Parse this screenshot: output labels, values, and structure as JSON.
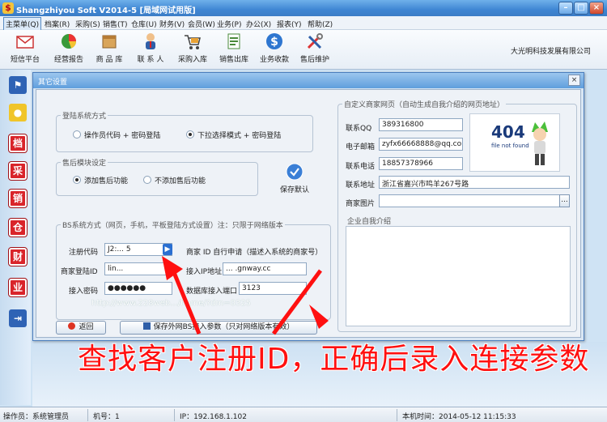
{
  "window": {
    "title": "Shangzhiyou Soft V2014-5 [局域网试用版]",
    "app_icon": "$"
  },
  "menu": [
    "主菜单(Q)",
    "档案(R)",
    "采购(S)",
    "销售(T)",
    "仓库(U)",
    "财务(V)",
    "会员(W)",
    "业务(P)",
    "办公(X)",
    "报表(Y)",
    "帮助(Z)"
  ],
  "toolbar": {
    "items": [
      "短信平台",
      "经营报告",
      "商 品 库",
      "联 系 人",
      "采购入库",
      "销售出库",
      "业务收款",
      "售后维护"
    ],
    "company": "大光明科技发展有限公司"
  },
  "sidebar": {
    "items": [
      "档",
      "采",
      "销",
      "仓",
      "财",
      "业"
    ]
  },
  "dialog": {
    "title": "其它设置",
    "close_glyph": "×",
    "login": {
      "legend": "登陆系统方式",
      "option1": "操作员代码 + 密码登陆",
      "option2": "下拉选择模式 + 密码登陆",
      "selected": 2
    },
    "aftersale": {
      "legend": "售后模块设定",
      "option1": "添加售后功能",
      "option2": "不添加售后功能",
      "selected": 1
    },
    "save_default": "保存默认",
    "bs": {
      "legend": "BS系统方式（网页，手机，平板登陆方式设置）注：只限于网络版本",
      "reg_label": "注册代码",
      "reg_value": "J2:... 5",
      "merchant_id_note": "商家 ID 自行申请（描述入系统的商家号）",
      "login_id_label": "商家登陆ID",
      "login_id_value": "lin...",
      "ip_label": "接入IP地址",
      "ip_value": "... .gnway.cc",
      "pwd_label": "接入密码",
      "pwd_value": "●●●●●●",
      "port_label": "数据库接入端口",
      "port_value": "3123",
      "link": "http://www.228web.../home/?dm=0325"
    },
    "back_button": "返回",
    "save_bs_button": "保存外网BS接入参数（只对网络版本有效）",
    "merchant": {
      "legend": "自定义商家网页（自动生成自我介绍的网页地址）",
      "qq_label": "联系QQ",
      "qq_value": "389316800",
      "email_label": "电子邮箱",
      "email_value": "zyfx66668888@qq.com",
      "phone_label": "联系电话",
      "phone_value": "18857378966",
      "address_label": "联系地址",
      "address_value": "浙江省嘉兴市鸣羊267号路",
      "image_label": "商家图片",
      "image_btn": "...",
      "intro_legend": "企业自我介绍",
      "img_404": "404",
      "img_404_sub": "file not found"
    }
  },
  "annotation": "查找客户注册ID，正确后录入连接参数",
  "status": {
    "operator": "操作员：系统管理员",
    "machine": "机号：1",
    "ip": "IP：192.168.1.102",
    "time": "本机时间：2014-05-12 11:15:33"
  },
  "colors": {
    "accent": "#3f86d3",
    "annotation": "#ff1010",
    "sidebar_red": "#d9242a"
  }
}
